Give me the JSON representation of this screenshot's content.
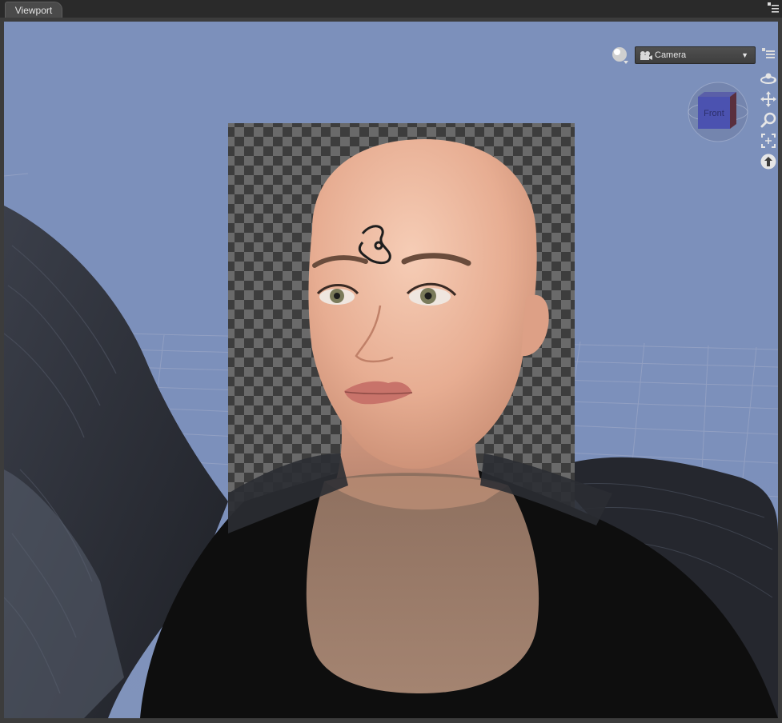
{
  "tab": {
    "title": "Viewport"
  },
  "toolbar": {
    "camera_label": "Camera",
    "camera_arrow": "▼"
  },
  "navcube": {
    "face_label": "Front"
  },
  "icons": {
    "panel_menu": "panel-menu-icon",
    "preview_sphere": "sphere-icon",
    "camera": "camera-icon",
    "viewport_menu": "viewport-menu-icon",
    "orbit": "orbit-icon",
    "pan": "pan-icon",
    "zoom": "zoom-icon",
    "frame": "frame-icon",
    "reset": "reset-icon"
  },
  "colors": {
    "sky": "#7c90bb",
    "panel": "#3c3c3c",
    "skin": "#e8b49a",
    "garment": "#111111",
    "wings": "#2d3038"
  }
}
